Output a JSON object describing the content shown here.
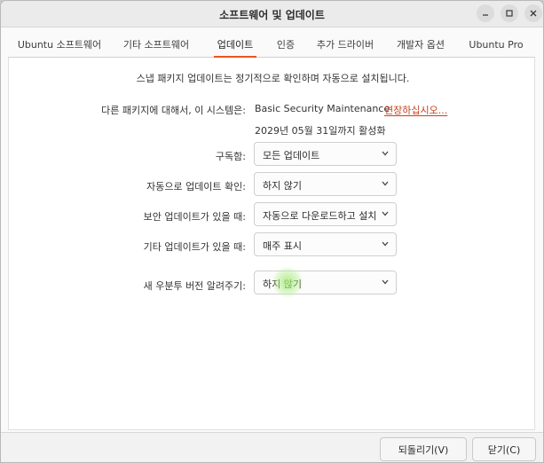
{
  "window": {
    "title": "소프트웨어 및 업데이트",
    "controls": [
      "minimize-icon",
      "maximize-icon",
      "close-icon"
    ]
  },
  "tabs": [
    {
      "label": "Ubuntu 소프트웨어",
      "active": false
    },
    {
      "label": "기타 소프트웨어",
      "active": false
    },
    {
      "label": "업데이트",
      "active": true
    },
    {
      "label": "인증",
      "active": false
    },
    {
      "label": "추가 드라이버",
      "active": false
    },
    {
      "label": "개발자 옵션",
      "active": false
    },
    {
      "label": "Ubuntu Pro",
      "active": false
    }
  ],
  "updates": {
    "snap_info": "스냅 패키지 업데이트는 정기적으로 확인하며 자동으로 설치됩니다.",
    "other_packages_label": "다른 패키지에 대해서, 이 시스템은:",
    "maintenance_value": "Basic Security Maintenance",
    "extend_link": "연장하십시오...",
    "active_until": "2029년 05월 31일까지 활성화",
    "subscribed_label": "구독함:",
    "subscribed_value": "모든 업데이트",
    "auto_check_label": "자동으로 업데이트 확인:",
    "auto_check_value": "하지 않기",
    "security_label": "보안 업데이트가 있을 때:",
    "security_value": "자동으로 다운로드하고 설치",
    "other_label": "기타 업데이트가 있을 때:",
    "other_value": "매주 표시",
    "notify_label": "새 우분투 버전 알려주기:",
    "notify_value": "하지 않기"
  },
  "footer": {
    "revert_label": "되돌리기(V)",
    "close_label": "닫기(C)"
  },
  "colors": {
    "accent": "#e95420",
    "link": "#c7401b"
  }
}
